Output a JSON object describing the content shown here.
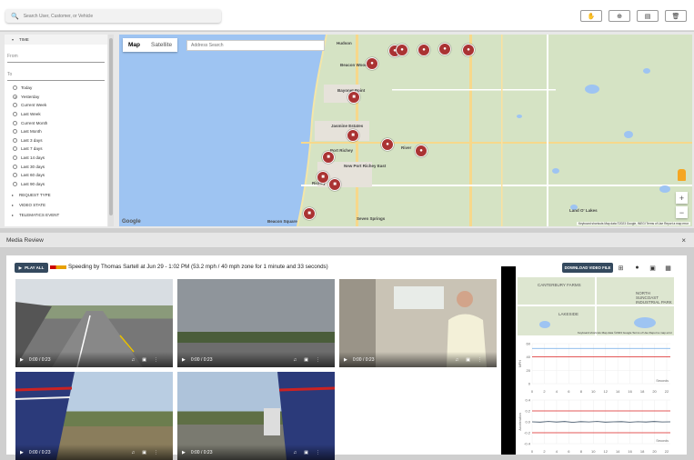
{
  "search": {
    "placeholder": "Search User, Customer, or Vehicle"
  },
  "toolbar": {
    "icons": [
      "hand-icon",
      "target-icon",
      "cart-icon",
      "trash-icon"
    ]
  },
  "filters": {
    "time_label": "TIME",
    "from_placeholder": "From",
    "to_placeholder": "To",
    "options": [
      "Today",
      "Yesterday",
      "Current Week",
      "Last Week",
      "Current Month",
      "Last Month",
      "Last 3 days",
      "Last 7 days",
      "Last 14 days",
      "Last 30 days",
      "Last 60 days",
      "Last 90 days"
    ],
    "selected": "Yesterday",
    "sections": [
      "REQUEST TYPE",
      "VIDEO STATE",
      "TELEMATICS EVENT"
    ]
  },
  "map": {
    "tab_map": "Map",
    "tab_satellite": "Satellite",
    "address_placeholder": "Address Search",
    "towns": [
      "Hudson",
      "Beacon Woods",
      "Bayonet Point",
      "Jasmine Estates",
      "Port Richey",
      "New Port Richey East",
      "Richey",
      "Land O' Lakes",
      "Seven Springs",
      "Beacon Square",
      "River"
    ],
    "attribution": "Keyboard shortcuts   Map data ©2023 Google, INEGI   Terms of Use   Report a map error",
    "google": "Google"
  },
  "media_review": {
    "title": "Media Review",
    "close": "×",
    "play_all": "PLAY ALL",
    "event_text": "Speeding by Thomas Sartell at Jun 29 - 1:02 PM (53.2 mph / 40 mph zone for 1 minute and 33 seconds)",
    "download": "DOWNLOAD VIDEO FILE",
    "video_time": "0:00 / 0:23",
    "video_count": 5,
    "minimap_labels": [
      "CANTERBURY FARMS",
      "NORTH SUNCOAST INDUSTRIAL PARK",
      "LAKESIDE"
    ],
    "minimap_attrib": "Keyboard shortcuts   Map data ©2023 Google   Terms of Use   Report a map error",
    "chart1": {
      "ylabel": "MPH",
      "yticks": [
        "60",
        "40",
        "20",
        "0"
      ],
      "xlabel": "Seconds"
    },
    "chart2": {
      "ylabel": "Acceleration",
      "yticks": [
        "0.4",
        "0.2",
        "0.0",
        "-0.2",
        "-0.4"
      ],
      "xlabel": "Seconds"
    },
    "xticks": [
      "0",
      "2",
      "4",
      "6",
      "8",
      "10",
      "12",
      "14",
      "16",
      "18",
      "20",
      "22"
    ]
  }
}
